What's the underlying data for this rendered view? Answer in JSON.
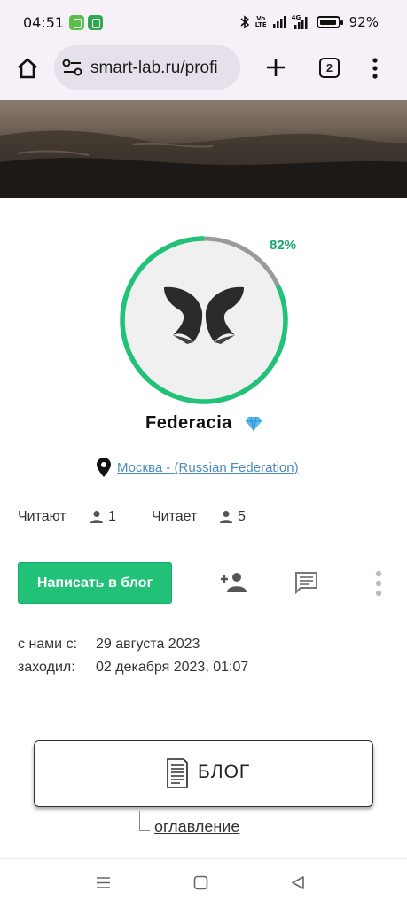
{
  "status_bar": {
    "time": "04:51",
    "network": "4G",
    "battery": "92%"
  },
  "browser": {
    "url": "smart-lab.ru/profi",
    "tab_count": "2"
  },
  "profile": {
    "progress_percent": 82,
    "progress_label": "82%",
    "name": "Federacia",
    "location": "Москва - (Russian Federation)",
    "followers_label": "Читают",
    "followers_count": "1",
    "following_label": "Читает",
    "following_count": "5",
    "write_button": "Написать в блог",
    "joined_label": "с нами с:",
    "joined_value": "29 августа 2023",
    "last_visit_label": "заходил:",
    "last_visit_value": "02 декабря 2023, 01:07",
    "blog_label": "БЛОГ",
    "toc_link": "оглавление"
  },
  "colors": {
    "accent_green": "#21c178",
    "link_blue": "#4c8bc0",
    "progress_track": "#9a9a9a"
  },
  "icons": [
    "home-icon",
    "site-settings-icon",
    "new-tab-icon",
    "menu-icon",
    "location-pin-icon",
    "person-icon",
    "add-person-icon",
    "message-icon",
    "more-vertical-icon",
    "diamond-icon",
    "document-icon"
  ]
}
